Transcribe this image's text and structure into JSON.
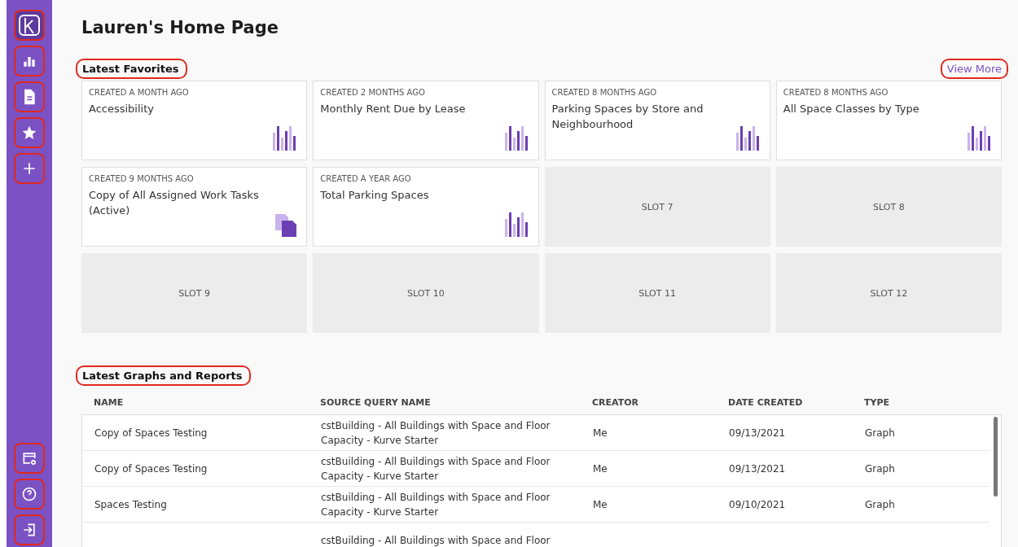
{
  "sidebar": {
    "top": [
      {
        "kind": "logo",
        "highlighted": true,
        "selected": true
      },
      {
        "kind": "chart",
        "highlighted": true,
        "selected": false
      },
      {
        "kind": "document",
        "highlighted": true,
        "selected": false
      },
      {
        "kind": "star",
        "highlighted": true,
        "selected": false
      },
      {
        "kind": "plus",
        "highlighted": true,
        "selected": false
      }
    ],
    "bottom": [
      {
        "kind": "settings",
        "highlighted": true
      },
      {
        "kind": "help",
        "highlighted": true
      },
      {
        "kind": "signin",
        "highlighted": true
      }
    ]
  },
  "page_title": "Lauren's Home Page",
  "favorites": {
    "title": "Latest Favorites",
    "title_highlighted": true,
    "view_more": "View More",
    "view_more_highlighted": true,
    "cards": [
      {
        "kind": "graph",
        "created": "CREATED A MONTH AGO",
        "title": "Accessibility"
      },
      {
        "kind": "graph",
        "created": "CREATED 2 MONTHS AGO",
        "title": "Monthly Rent Due by Lease"
      },
      {
        "kind": "graph",
        "created": "CREATED 8 MONTHS AGO",
        "title": "Parking Spaces by Store and Neighbourhood"
      },
      {
        "kind": "graph",
        "created": "CREATED 8 MONTHS AGO",
        "title": "All Space Classes by Type"
      },
      {
        "kind": "report",
        "created": "CREATED 9 MONTHS AGO",
        "title": "Copy of All Assigned Work Tasks (Active)"
      },
      {
        "kind": "graph",
        "created": "CREATED A YEAR AGO",
        "title": "Total Parking Spaces"
      },
      {
        "kind": "slot",
        "label": "SLOT 7"
      },
      {
        "kind": "slot",
        "label": "SLOT 8"
      },
      {
        "kind": "slot",
        "label": "SLOT 9"
      },
      {
        "kind": "slot",
        "label": "SLOT 10"
      },
      {
        "kind": "slot",
        "label": "SLOT 11"
      },
      {
        "kind": "slot",
        "label": "SLOT 12"
      }
    ]
  },
  "reports": {
    "title": "Latest Graphs and Reports",
    "title_highlighted": true,
    "columns": [
      "NAME",
      "SOURCE QUERY NAME",
      "CREATOR",
      "DATE CREATED",
      "TYPE"
    ],
    "rows": [
      [
        "Copy of Spaces Testing",
        "cstBuilding - All Buildings with Space and Floor Capacity - Kurve Starter",
        "Me",
        "09/13/2021",
        "Graph"
      ],
      [
        "Copy of Spaces Testing",
        "cstBuilding - All Buildings with Space and Floor Capacity - Kurve Starter",
        "Me",
        "09/13/2021",
        "Graph"
      ],
      [
        "Spaces Testing",
        "cstBuilding - All Buildings with Space and Floor Capacity - Kurve Starter",
        "Me",
        "09/10/2021",
        "Graph"
      ],
      [
        "",
        "cstBuilding - All Buildings with Space and Floor",
        "",
        "",
        ""
      ]
    ]
  }
}
